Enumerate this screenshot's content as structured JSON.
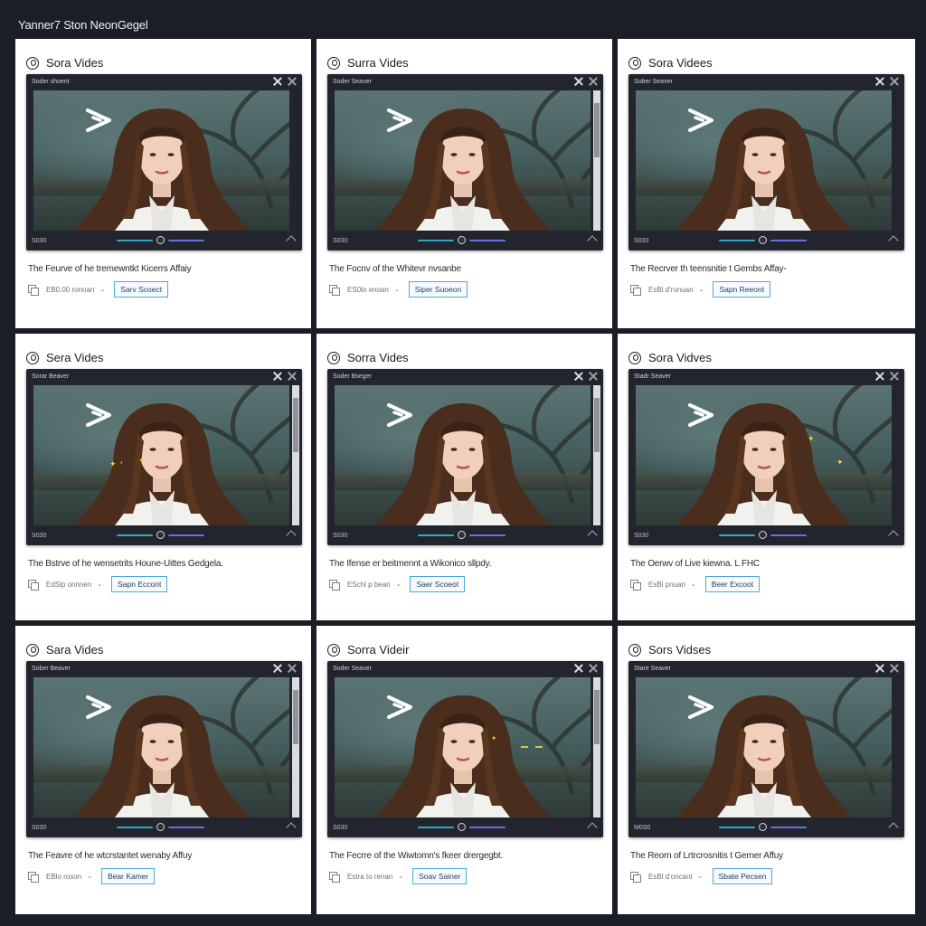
{
  "page": {
    "title": "Yanner7 Ston NeonGegel"
  },
  "cards": [
    {
      "title": "Sora Vides",
      "player_label": "Soder  shoent",
      "time": "S030",
      "caption": "The Feurve of he tremewntkt Kicerrs Affaiy",
      "meta": "EB0.00 ronoan",
      "button": "Sarv Scoect",
      "scrollbar": false
    },
    {
      "title": "Surra Vides",
      "player_label": "Soder  Seaver",
      "time": "S030",
      "caption": "The Focnv of the Whitevr nvsanbe",
      "meta": "ES0lo enoan",
      "button": "Siper Suoeon",
      "scrollbar": true
    },
    {
      "title": "Sora Videes",
      "player_label": "Sober  Seaver",
      "time": "S030",
      "caption": "The Recrver th teensnitie t Gembs Affay-",
      "meta": "EsBl d'ronuan",
      "button": "Sapn Reeont",
      "scrollbar": false
    },
    {
      "title": "Sera Vides",
      "player_label": "Sorar  Beaver",
      "time": "S030",
      "caption": "The Bstrve of he wensetrits Houne-Uittes Gedgela.",
      "meta": "EdSlp onnnen",
      "button": "Sapn Eccont",
      "scrollbar": true
    },
    {
      "title": "Sorra Vides",
      "player_label": "Soder  Bseger",
      "time": "S030",
      "caption": "The Ifense er beitmennt a Wikonico sllpdy.",
      "meta": "ESchl p bean",
      "button": "Saer Scoeot",
      "scrollbar": true
    },
    {
      "title": "Sora Vidves",
      "player_label": "Stadr  Seaver",
      "time": "S030",
      "caption": "The Oerwv of Live kiewna. L FHC",
      "meta": "EsBl pnuan",
      "button": "Beer Excoot",
      "scrollbar": false
    },
    {
      "title": "Sara Vides",
      "player_label": "Sober  Beaver",
      "time": "S030",
      "caption": "The Feavre of he wtcrstantet wenaby Affuy",
      "meta": "EBlo roson",
      "button": "Bear Kamer",
      "scrollbar": true
    },
    {
      "title": "Sorra Videir",
      "player_label": "Soder  Seaver",
      "time": "S030",
      "caption": "The Fecrre of the Wiwtomn's fkeer drergegbt.",
      "meta": "Estra to renan",
      "button": "Soav Sainer",
      "scrollbar": true
    },
    {
      "title": "Sors Vidses",
      "player_label": "Stare  Seaver",
      "time": "M0S0",
      "caption": "The Reorn of Lrtrcrosnitis t Gerner Affuy",
      "meta": "EsBl d'oncant",
      "button": "Sbate Pecsen",
      "scrollbar": false
    }
  ]
}
